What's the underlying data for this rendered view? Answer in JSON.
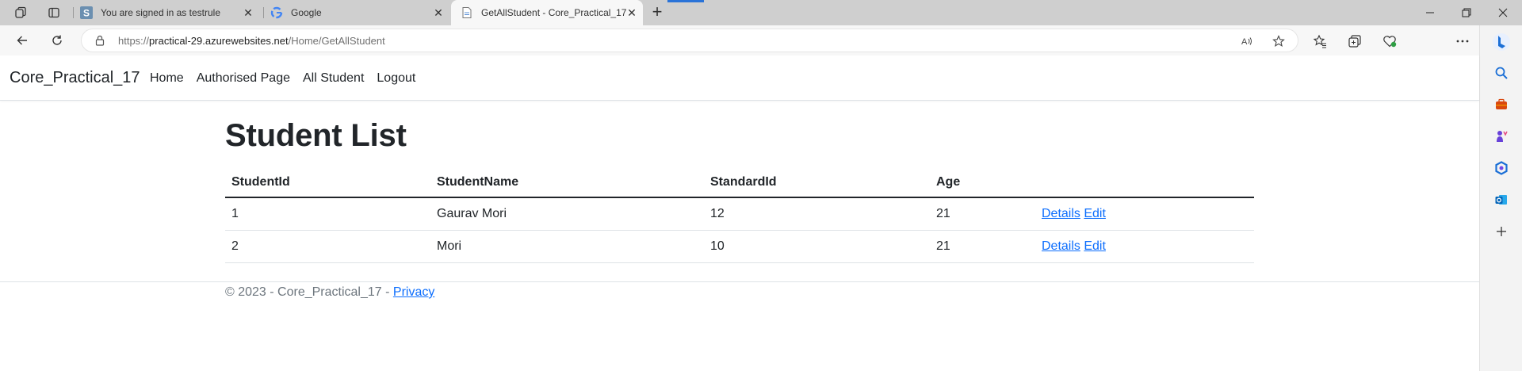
{
  "browser": {
    "tabs": [
      {
        "title": "You are signed in as testrule",
        "favicon": "s-square-icon",
        "active": false
      },
      {
        "title": "Google",
        "favicon": "google-icon",
        "active": false
      },
      {
        "title": "GetAllStudent - Core_Practical_17",
        "favicon": "page-icon",
        "active": true
      }
    ],
    "address": {
      "scheme": "https://",
      "host": "practical-29.azurewebsites.net",
      "path": "/Home/GetAllStudent"
    },
    "accent_color": "#2a73d8"
  },
  "site": {
    "brand": "Core_Practical_17",
    "nav": [
      {
        "label": "Home"
      },
      {
        "label": "Authorised Page"
      },
      {
        "label": "All Student"
      },
      {
        "label": "Logout"
      }
    ]
  },
  "main": {
    "heading": "Student List",
    "table": {
      "columns": [
        "StudentId",
        "StudentName",
        "StandardId",
        "Age",
        ""
      ],
      "rows": [
        {
          "id": "1",
          "name": "Gaurav Mori",
          "standard": "12",
          "age": "21",
          "details": "Details",
          "edit": "Edit"
        },
        {
          "id": "2",
          "name": "Mori",
          "standard": "10",
          "age": "21",
          "details": "Details",
          "edit": "Edit"
        }
      ]
    },
    "link_color": "#0d6efd"
  },
  "footer": {
    "text": "© 2023 - Core_Practical_17 - ",
    "privacy_label": "Privacy"
  }
}
